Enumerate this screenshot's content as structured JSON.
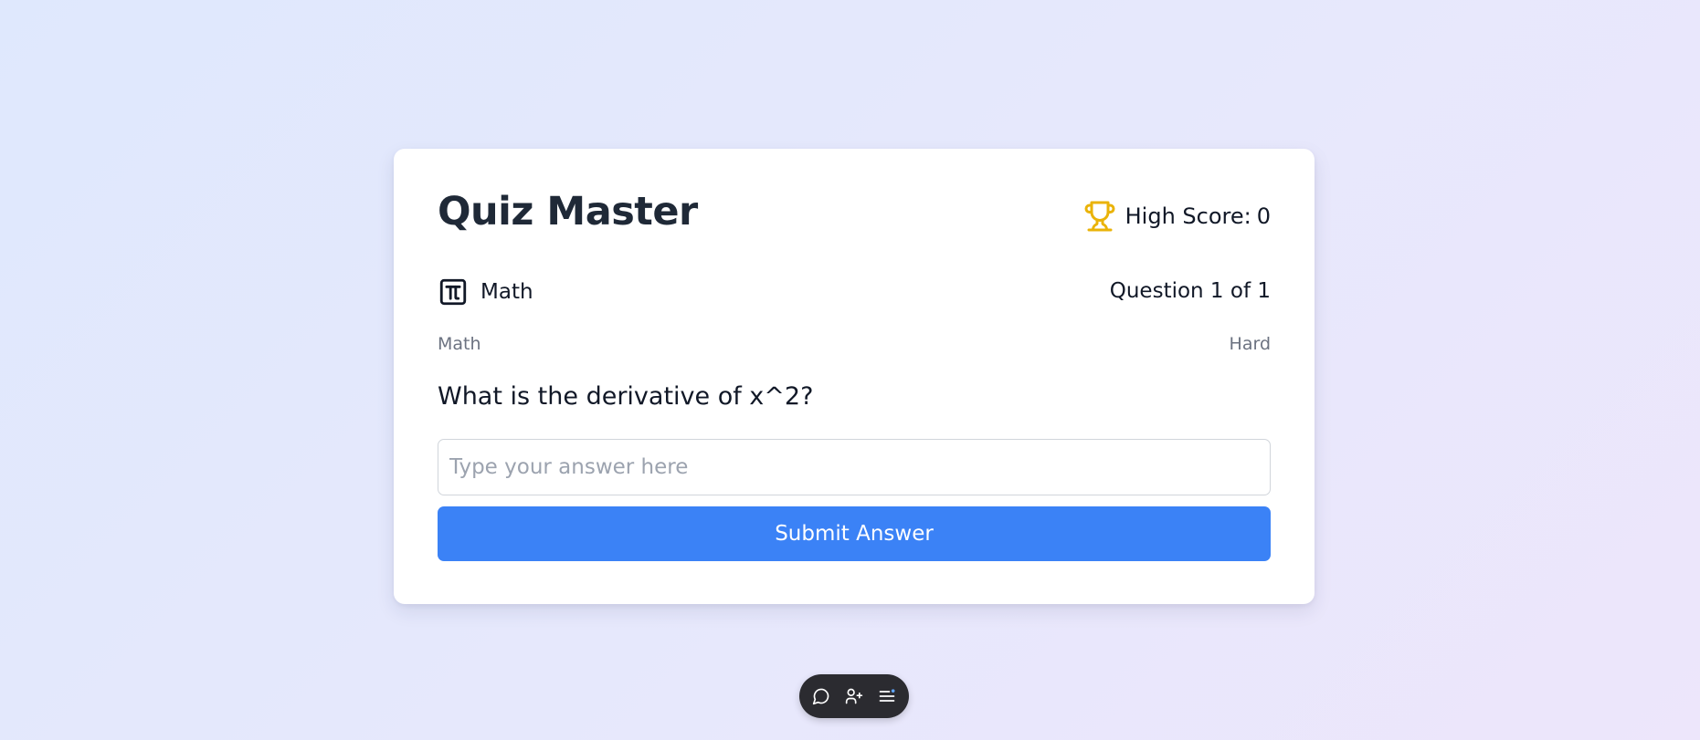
{
  "app": {
    "title": "Quiz Master"
  },
  "high_score": {
    "label": "High Score:",
    "value": "0",
    "icon": "trophy-icon",
    "icon_color": "#eab308"
  },
  "subject": {
    "icon": "pi-icon",
    "name": "Math"
  },
  "progress": {
    "text": "Question 1 of 1"
  },
  "meta": {
    "category": "Math",
    "difficulty": "Hard"
  },
  "question": {
    "text": "What is the derivative of x^2?"
  },
  "answer": {
    "value": "",
    "placeholder": "Type your answer here"
  },
  "submit": {
    "label": "Submit Answer",
    "color": "#3b82f6"
  },
  "dock": {
    "items": [
      "chat-icon",
      "add-user-icon",
      "menu-icon"
    ],
    "notification_dot_color": "#60a5fa"
  }
}
